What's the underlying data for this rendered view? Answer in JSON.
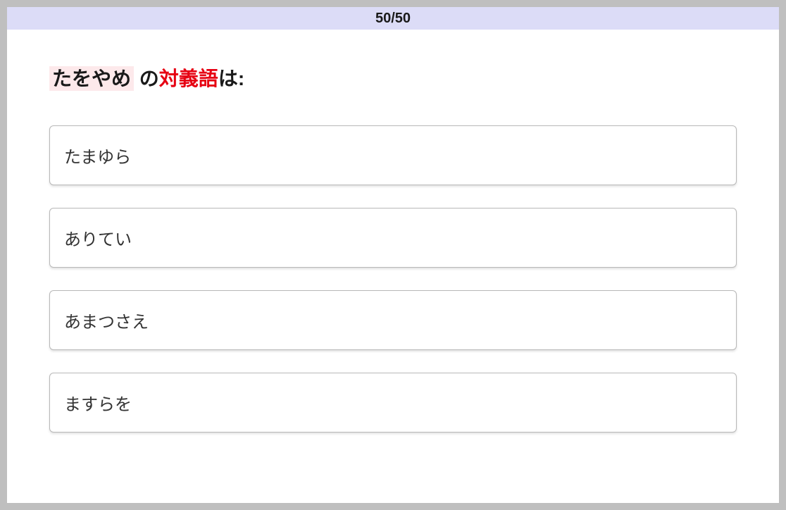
{
  "progress": {
    "text": "50/50"
  },
  "question": {
    "highlighted_word": "たをやめ",
    "middle_text": " の",
    "red_text": "対義語",
    "suffix_text": "は:"
  },
  "options": [
    {
      "label": "たまゆら"
    },
    {
      "label": "ありてい"
    },
    {
      "label": "あまつさえ"
    },
    {
      "label": "ますらを"
    }
  ]
}
